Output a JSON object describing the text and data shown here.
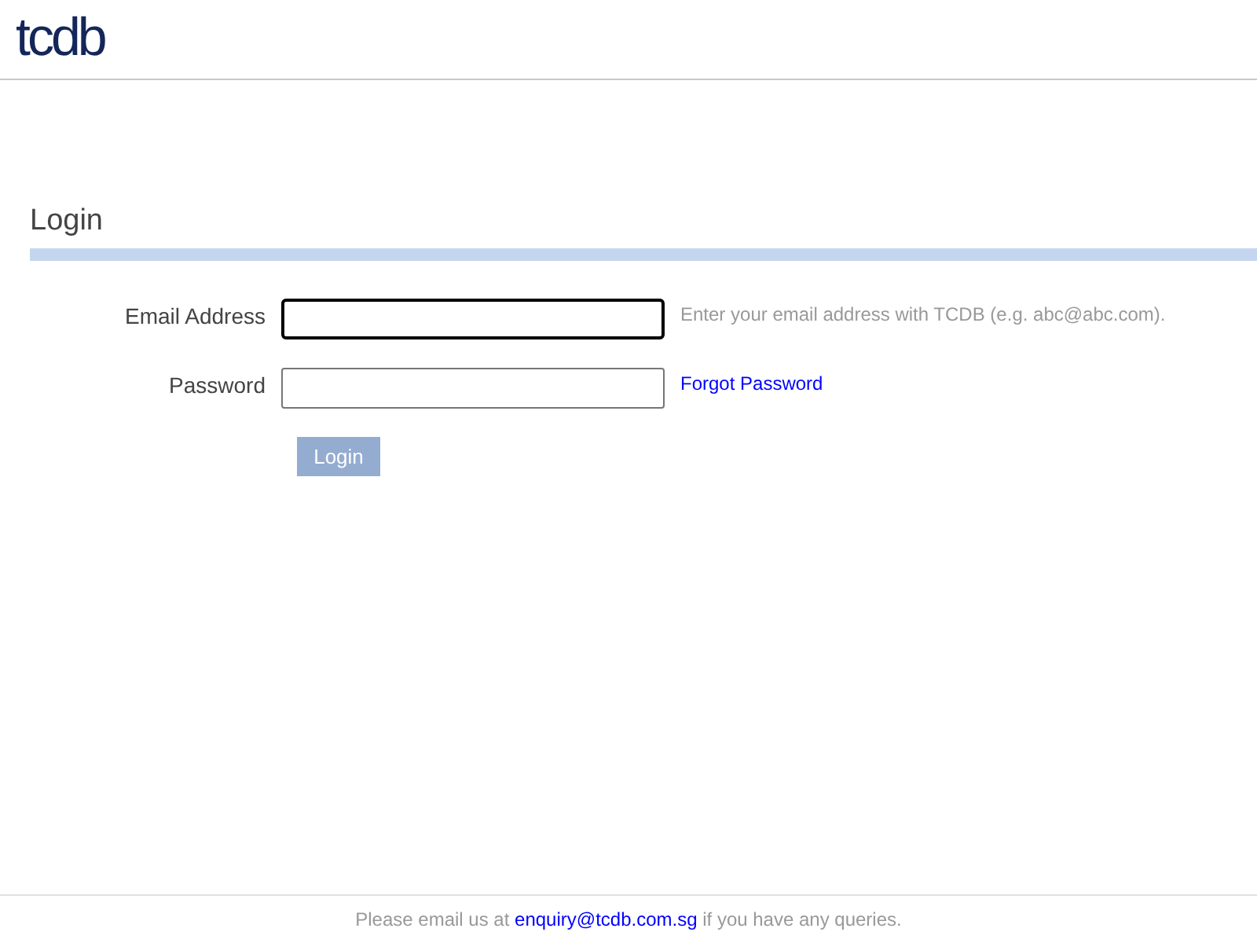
{
  "logo": "tcdb",
  "title": "Login",
  "fields": [
    {
      "label": "Email Address",
      "focused": true,
      "aside": {
        "kind": "hint",
        "text": "Enter your email address with TCDB (e.g. abc@abc.com)."
      }
    },
    {
      "label": "Password",
      "focused": false,
      "aside": {
        "kind": "link",
        "text": "Forgot Password"
      }
    }
  ],
  "login_button": "Login",
  "footer": {
    "before": "Please email us at",
    "link": "enquiry@tcdb.com.sg",
    "after": "if you have any queries."
  }
}
